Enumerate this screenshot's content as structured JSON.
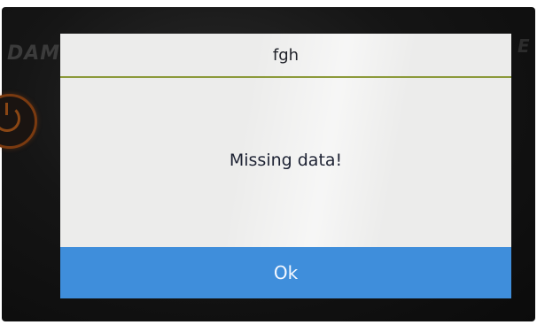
{
  "device": {
    "brand_left": "DAM",
    "brand_right": "E"
  },
  "dialog": {
    "title": "fgh",
    "message": "Missing data!",
    "ok_label": "Ok"
  },
  "icons": {
    "power": "power-icon"
  },
  "colors": {
    "ok_button": "#3f8edb",
    "divider": "#8c9a3a",
    "dialog_bg": "#ececeb"
  }
}
